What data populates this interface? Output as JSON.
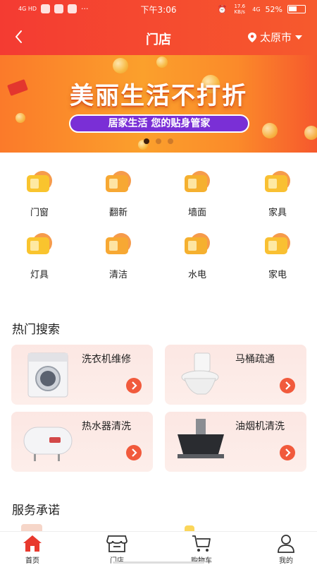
{
  "status_bar": {
    "network": "4G HD",
    "time": "下午3:06",
    "speed": "17.6 KB/s",
    "signal": "4G",
    "battery": "52%",
    "battery_level": 0.52
  },
  "header": {
    "title": "门店",
    "city": "太原市"
  },
  "banner": {
    "headline": "美丽生活不打折",
    "subline": "居家生活 您的贴身管家",
    "slide_count": 3,
    "active_slide": 1
  },
  "categories": [
    {
      "label": "门窗",
      "icon": "window-icon"
    },
    {
      "label": "翻新",
      "icon": "renovate-icon"
    },
    {
      "label": "墙面",
      "icon": "wall-icon"
    },
    {
      "label": "家具",
      "icon": "furniture-icon"
    },
    {
      "label": "灯具",
      "icon": "lamp-icon"
    },
    {
      "label": "清洁",
      "icon": "cleaning-icon"
    },
    {
      "label": "水电",
      "icon": "plumbing-icon"
    },
    {
      "label": "家电",
      "icon": "appliance-icon"
    }
  ],
  "hot_search": {
    "title": "热门搜索",
    "items": [
      {
        "label": "洗衣机维修",
        "icon": "washing-machine-icon"
      },
      {
        "label": "马桶疏通",
        "icon": "toilet-icon"
      },
      {
        "label": "热水器清洗",
        "icon": "water-heater-icon"
      },
      {
        "label": "油烟机清洗",
        "icon": "range-hood-icon"
      }
    ]
  },
  "service": {
    "title": "服务承诺"
  },
  "tabs": [
    {
      "label": "首页",
      "icon": "home-icon",
      "active": true
    },
    {
      "label": "门店",
      "icon": "store-icon",
      "active": false
    },
    {
      "label": "购物车",
      "icon": "cart-icon",
      "active": false
    },
    {
      "label": "我的",
      "icon": "user-icon",
      "active": false
    }
  ],
  "colors": {
    "brand": "#f43b32",
    "accent": "#f15a3c",
    "card_bg": "#fce7e3",
    "banner_pill": "#7a2fd6"
  }
}
